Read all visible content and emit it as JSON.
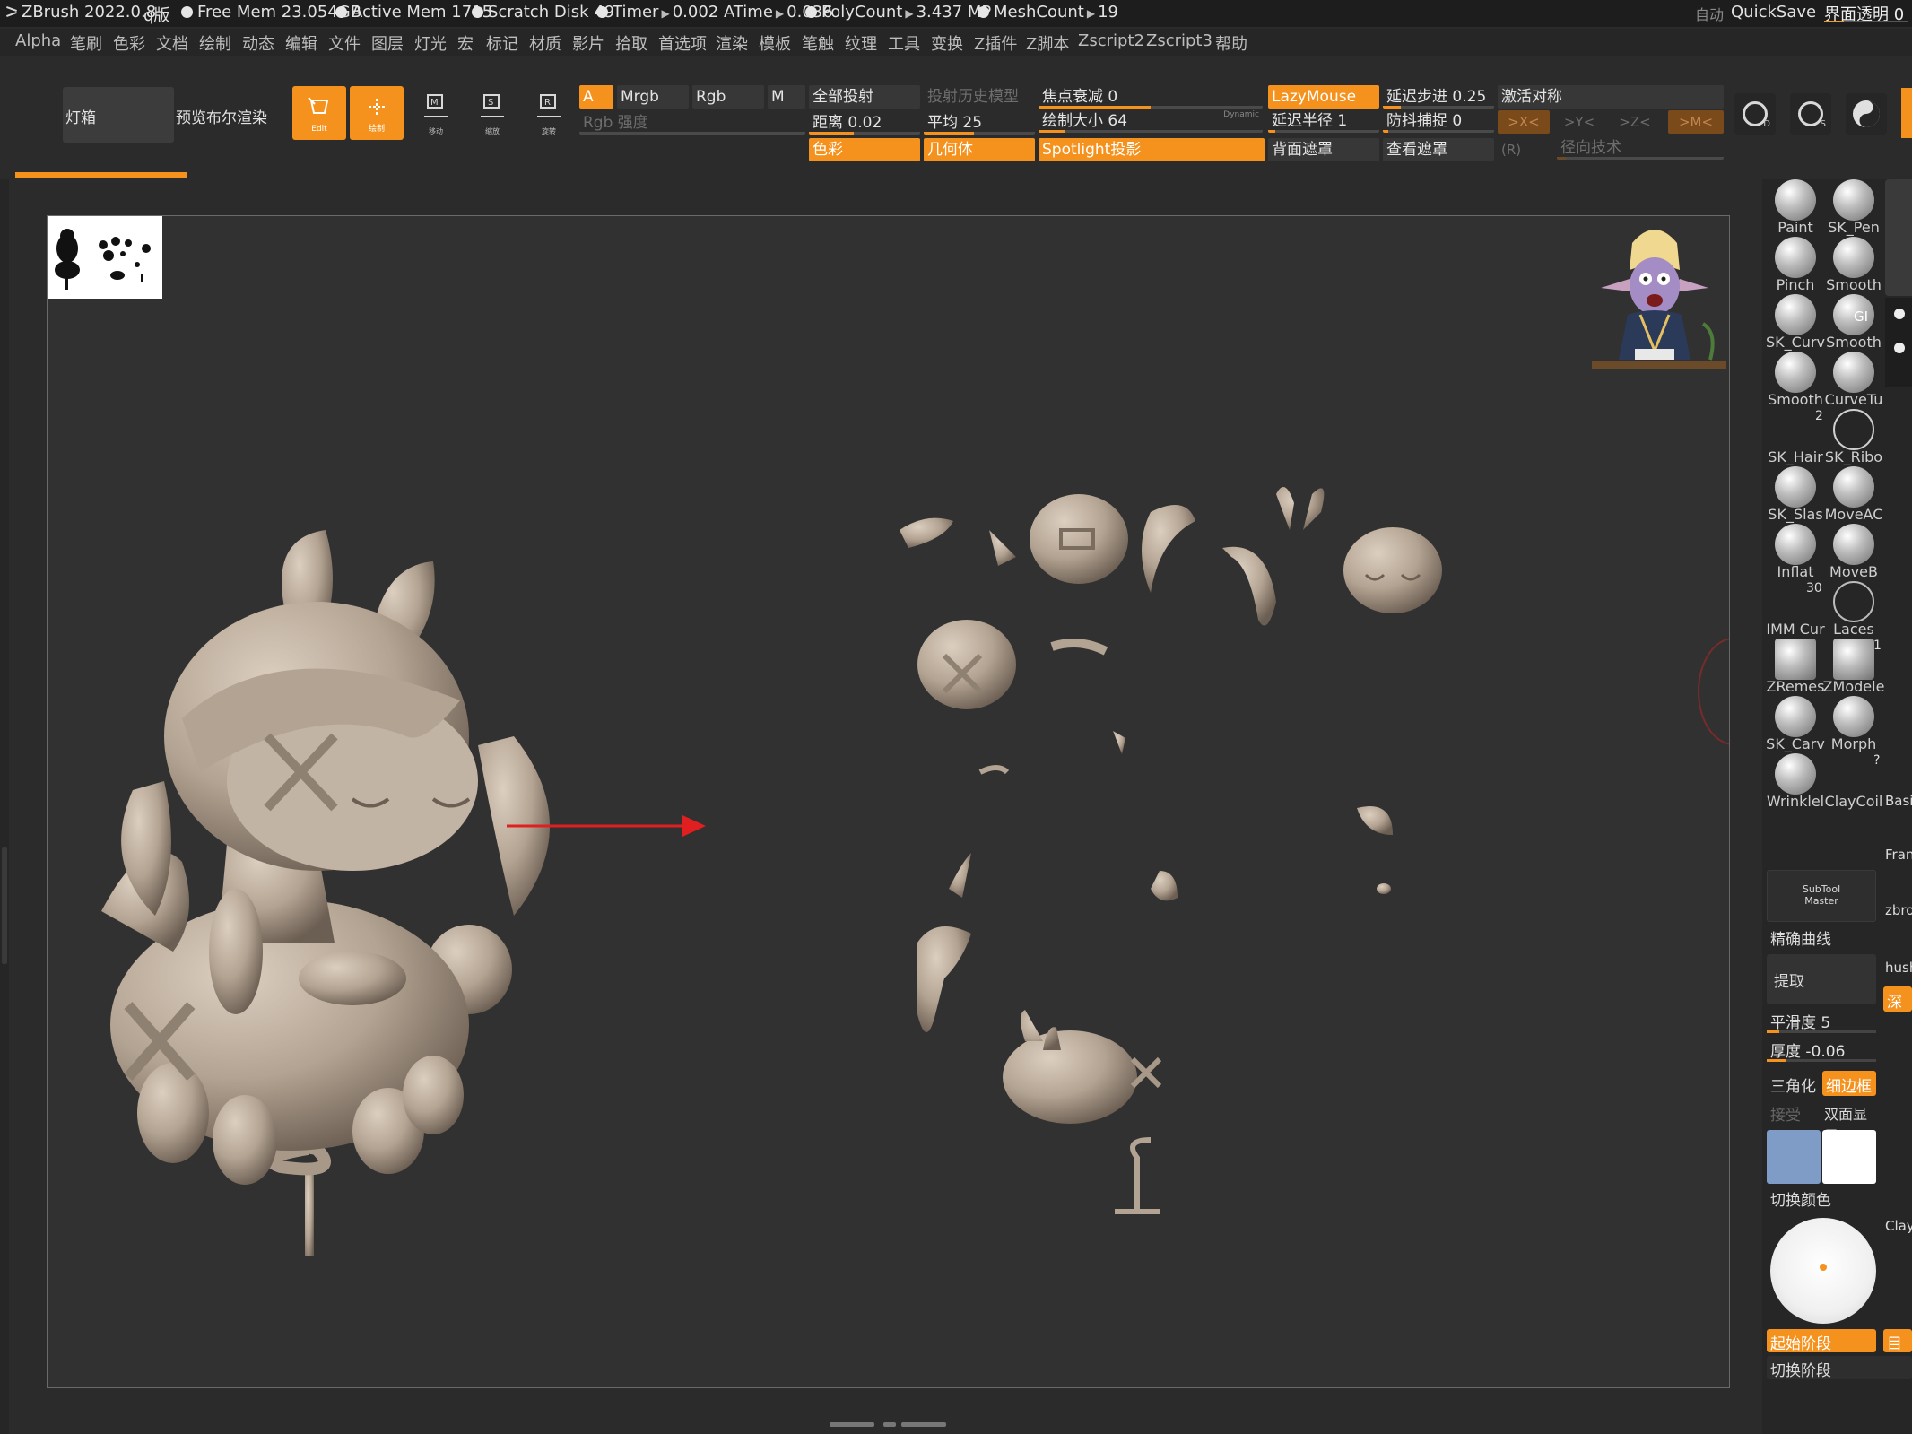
{
  "titlebar": {
    "app": "ZBrush 2022.0.8",
    "edition": "q版",
    "free_mem": "Free Mem 23.054GB",
    "active_mem": "Active Mem 1715",
    "scratch": "Scratch Disk 49",
    "timer_label": "Timer",
    "timer_value": "0.002",
    "atime_label": "ATime",
    "atime_value": "0.036",
    "poly_label": "PolyCount",
    "poly_value": "3.437 MP",
    "mesh_label": "MeshCount",
    "mesh_value": "19",
    "auto_label": "自动",
    "quicksave": "QuickSave",
    "ui_transparency": "界面透明 0"
  },
  "menu": [
    "Alpha",
    "笔刷",
    "色彩",
    "文档",
    "绘制",
    "动态",
    "编辑",
    "文件",
    "图层",
    "灯光",
    "宏",
    "标记",
    "材质",
    "影片",
    "拾取",
    "首选项",
    "渲染",
    "模板",
    "笔触",
    "纹理",
    "工具",
    "变换",
    "Z插件",
    "Z脚本",
    "Zscript2",
    "Zscript3",
    "帮助"
  ],
  "toolbar": {
    "lightbox": "灯箱",
    "bpr": "预览布尔渲染",
    "edit_caption": "Edit",
    "draw_caption": "绘制",
    "move_caption": "移动",
    "scale_caption": "缩放",
    "rotate_caption": "旋转",
    "a_label": "A",
    "mrgb": "Mrgb",
    "rgb": "Rgb",
    "m": "M",
    "rgb_intensity": "Rgb 强度",
    "project_all": "全部投射",
    "project_history": "投射历史模型",
    "distance": "距离 0.02",
    "mean": "平均 25",
    "color": "色彩",
    "geometry": "几何体",
    "spotlight": "Spotlight投影",
    "focal_shift": "焦点衰减 0",
    "draw_size": "绘制大小 64",
    "dynamic": "Dynamic",
    "lazymouse": "LazyMouse",
    "lazy_radius": "延迟半径 1",
    "backface_mask": "背面遮罩",
    "lazy_step": "延迟步进 0.25",
    "lazy_snap": "防抖捕捉 0",
    "view_mask": "查看遮罩",
    "activate_symmetry": "激活对称",
    "sym_x": ">X<",
    "sym_y": ">Y<",
    "sym_z": ">Z<",
    "sym_m": ">M<",
    "sym_r": "(R)",
    "radial": "径向技术",
    "btn_d": "D",
    "btn_s": "S"
  },
  "sliders": {
    "draw_size_fraction": 0.12,
    "focal_fraction": 0.5,
    "distance_fraction": 0.4,
    "mean_fraction": 0.45
  },
  "brushes": [
    {
      "label": "Paint"
    },
    {
      "label": "SK_Pen"
    },
    {
      "label": "Pinch"
    },
    {
      "label": "Smooth"
    },
    {
      "label": "SK_Curv"
    },
    {
      "label": "Smooth"
    },
    {
      "label": "Smooth"
    },
    {
      "label": "CurveTu"
    },
    {
      "label": "SK_Hair"
    },
    {
      "label": "SK_Ribo"
    },
    {
      "label": "SK_Slas"
    },
    {
      "label": "MoveAC"
    },
    {
      "label": "Inflat"
    },
    {
      "label": "MoveB"
    },
    {
      "label": "IMM Cur"
    },
    {
      "label": "Laces"
    },
    {
      "label": "ZRemes"
    },
    {
      "label": "ZModele"
    },
    {
      "label": "SK_Carv"
    },
    {
      "label": "Morph"
    },
    {
      "label": "Wrinklel"
    },
    {
      "label": "ClayCoil"
    }
  ],
  "brush_badges": {
    "gi": "GI",
    "hair": "2",
    "imm": "30",
    "zmodeler": "1",
    "claycoil": "?"
  },
  "side_labels": [
    "Fran",
    "zbro",
    "hush",
    "Clay",
    "Basi"
  ],
  "palette": {
    "subtool_master": "SubTool\nMaster",
    "precise_curve": "精确曲线",
    "extract": "提取",
    "smoothness": "平滑度 5",
    "thickness": "厚度 -0.06",
    "triangulate": "三角化",
    "fine_border": "细边框",
    "accept": "接受",
    "double_sided": "双面显示",
    "depth_frag": "深度",
    "switch_color": "切换颜色",
    "start_stage": "起始阶段",
    "target_frag": "目标",
    "switch_stage": "切换阶段"
  },
  "colors": {
    "accent": "#f5921e",
    "swatch_main": "#7f9cc6",
    "swatch_secondary": "#ffffff",
    "arrow": "#e02020",
    "model": "#b7a796"
  }
}
